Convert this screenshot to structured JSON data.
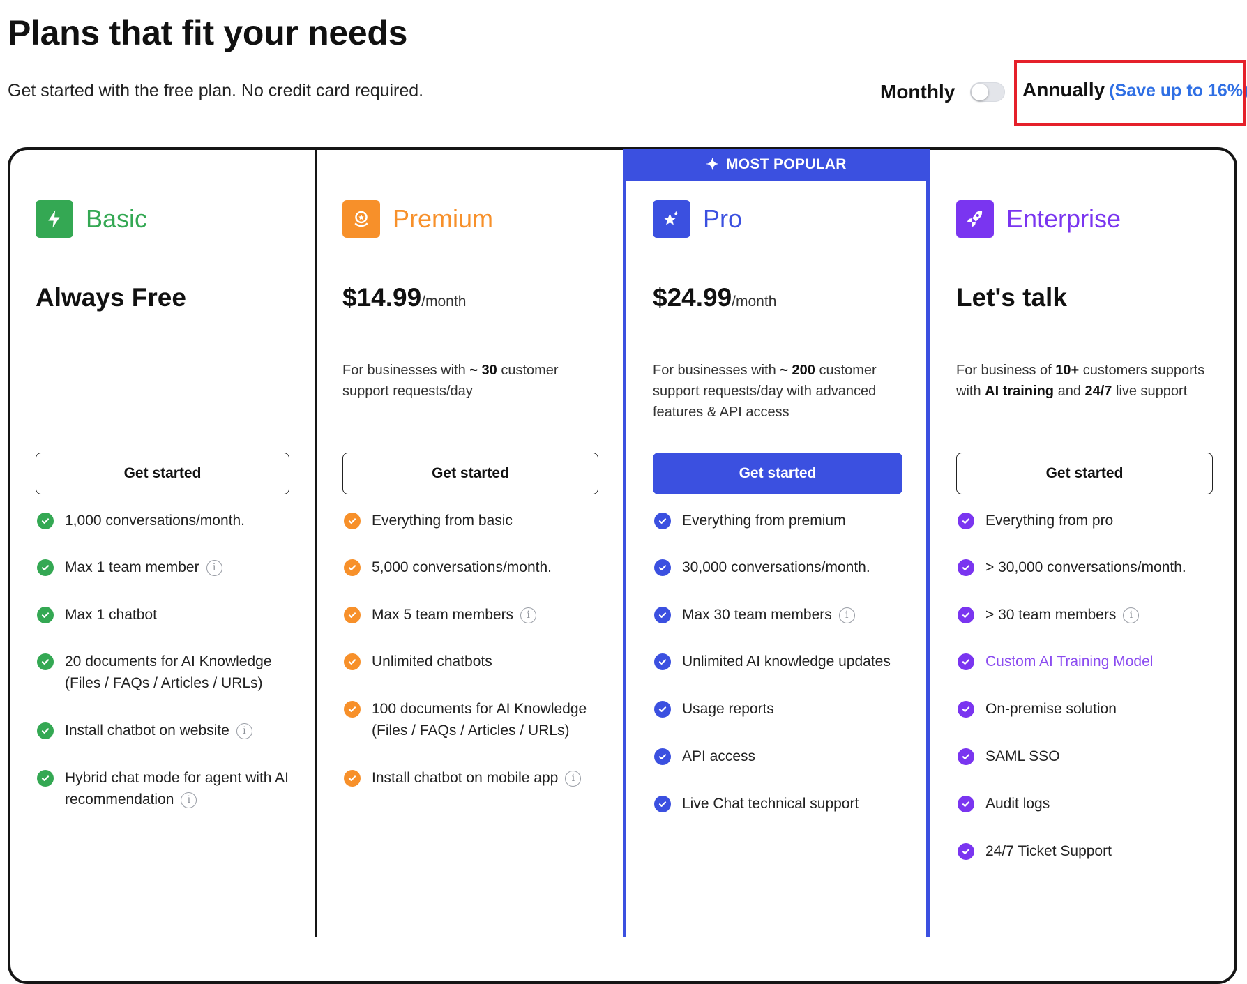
{
  "header": {
    "title": "Plans that fit your needs",
    "subtitle": "Get started with the free plan. No credit card required."
  },
  "billing": {
    "monthly_label": "Monthly",
    "annual_label": "Annually",
    "annual_note": "(Save up to 16%)",
    "toggle_state": "monthly"
  },
  "banner": {
    "label": "MOST POPULAR",
    "icon": "sparkles-icon"
  },
  "colors": {
    "basic": "#34a853",
    "premium": "#f7902a",
    "pro": "#3b50e0",
    "enterprise": "#7a35f0",
    "highlight_box": "#e5202a"
  },
  "plans": [
    {
      "id": "basic",
      "name": "Basic",
      "icon": "lightning-icon",
      "price": "Always Free",
      "per": "",
      "desc_html": "",
      "cta": "Get started",
      "features": [
        {
          "text": "1,000 conversations/month.",
          "info": false
        },
        {
          "text": "Max 1 team member",
          "info": true
        },
        {
          "text": "Max 1 chatbot",
          "info": false
        },
        {
          "text": "20 documents for AI Knowledge (Files / FAQs / Articles / URLs)",
          "info": false
        },
        {
          "text": "Install chatbot on website",
          "info": true
        },
        {
          "text": "Hybrid chat mode for agent with AI recommendation",
          "info": true
        }
      ]
    },
    {
      "id": "premium",
      "name": "Premium",
      "icon": "award-icon",
      "price": "$14.99",
      "per": "/month",
      "desc_html": "For businesses with <b>~ 30</b> customer support requests/day",
      "cta": "Get started",
      "features": [
        {
          "text": "Everything from basic",
          "info": false
        },
        {
          "text": "5,000 conversations/month.",
          "info": false
        },
        {
          "text": "Max 5 team members",
          "info": true
        },
        {
          "text": "Unlimited chatbots",
          "info": false
        },
        {
          "text": "100 documents for AI Knowledge (Files / FAQs / Articles / URLs)",
          "info": false
        },
        {
          "text": "Install chatbot on mobile app",
          "info": true
        }
      ]
    },
    {
      "id": "pro",
      "name": "Pro",
      "icon": "star-icon",
      "price": "$24.99",
      "per": "/month",
      "desc_html": "For businesses with <b>~ 200</b> customer support requests/day with advanced features &amp; API access",
      "cta": "Get started",
      "features": [
        {
          "text": "Everything from premium",
          "info": false
        },
        {
          "text": "30,000 conversations/month.",
          "info": false
        },
        {
          "text": "Max 30 team members",
          "info": true
        },
        {
          "text": "Unlimited AI knowledge updates",
          "info": false
        },
        {
          "text": "Usage reports",
          "info": false
        },
        {
          "text": "API access",
          "info": false
        },
        {
          "text": "Live Chat technical support",
          "info": false
        }
      ]
    },
    {
      "id": "enterprise",
      "name": "Enterprise",
      "icon": "rocket-icon",
      "price": "Let's talk",
      "per": "",
      "desc_html": "For business of <b>10+</b> customers supports with <b>AI training</b> and <b>24/7</b> live support",
      "cta": "Get started",
      "features": [
        {
          "text": "Everything from pro",
          "info": false
        },
        {
          "text": "> 30,000 conversations/month.",
          "info": false
        },
        {
          "text": "> 30 team members",
          "info": true
        },
        {
          "text": "Custom AI Training Model",
          "info": false,
          "link": true
        },
        {
          "text": "On-premise solution",
          "info": false
        },
        {
          "text": "SAML SSO",
          "info": false
        },
        {
          "text": "Audit logs",
          "info": false
        },
        {
          "text": "24/7 Ticket Support",
          "info": false
        }
      ]
    }
  ]
}
